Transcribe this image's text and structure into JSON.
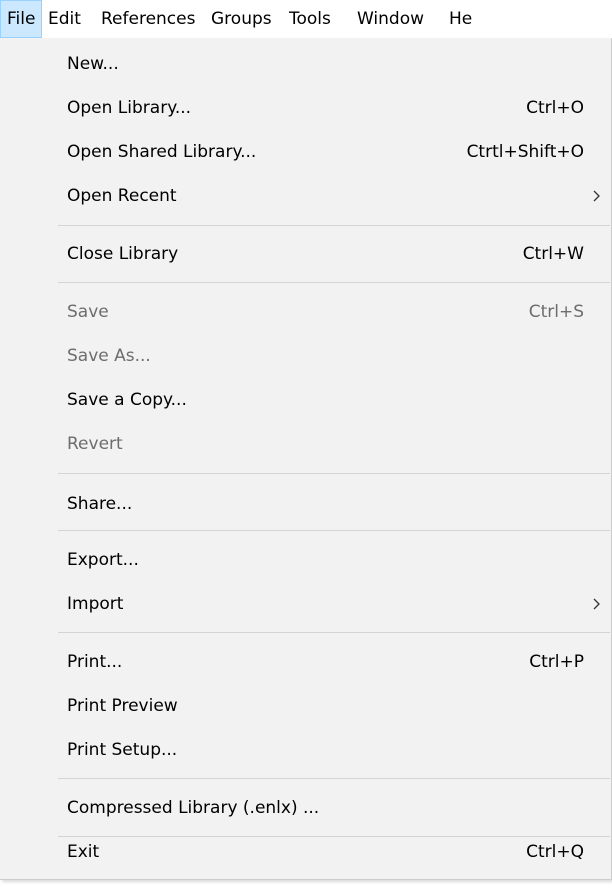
{
  "menubar": {
    "items": [
      {
        "label": "File"
      },
      {
        "label": "Edit"
      },
      {
        "label": "References"
      },
      {
        "label": "Groups"
      },
      {
        "label": "Tools"
      },
      {
        "label": "Window"
      },
      {
        "label": "He"
      }
    ]
  },
  "file_menu": {
    "new": {
      "label": "New..."
    },
    "open_library": {
      "label": "Open Library...",
      "shortcut": "Ctrl+O"
    },
    "open_shared": {
      "label": "Open Shared Library...",
      "shortcut": "Ctrtl+Shift+O"
    },
    "open_recent": {
      "label": "Open Recent",
      "submenu_icon": "chevron-right-icon"
    },
    "close_library": {
      "label": "Close Library",
      "shortcut": "Ctrl+W"
    },
    "save": {
      "label": "Save",
      "shortcut": "Ctrl+S"
    },
    "save_as": {
      "label": "Save As..."
    },
    "save_copy": {
      "label": "Save a Copy..."
    },
    "revert": {
      "label": "Revert"
    },
    "share": {
      "label": "Share..."
    },
    "export": {
      "label": "Export..."
    },
    "import": {
      "label": "Import",
      "submenu_icon": "chevron-right-icon"
    },
    "print": {
      "label": "Print...",
      "shortcut": "Ctrl+P"
    },
    "print_preview": {
      "label": "Print Preview"
    },
    "print_setup": {
      "label": "Print Setup..."
    },
    "compressed": {
      "label": "Compressed Library (.enlx) ..."
    },
    "exit": {
      "label": "Exit",
      "shortcut": "Ctrl+Q"
    }
  },
  "colors": {
    "menu_background": "#f2f2f2",
    "active_menubar_item": "#cce8ff",
    "disabled_text": "#6d6d6d",
    "separator": "#d4d4d4"
  }
}
